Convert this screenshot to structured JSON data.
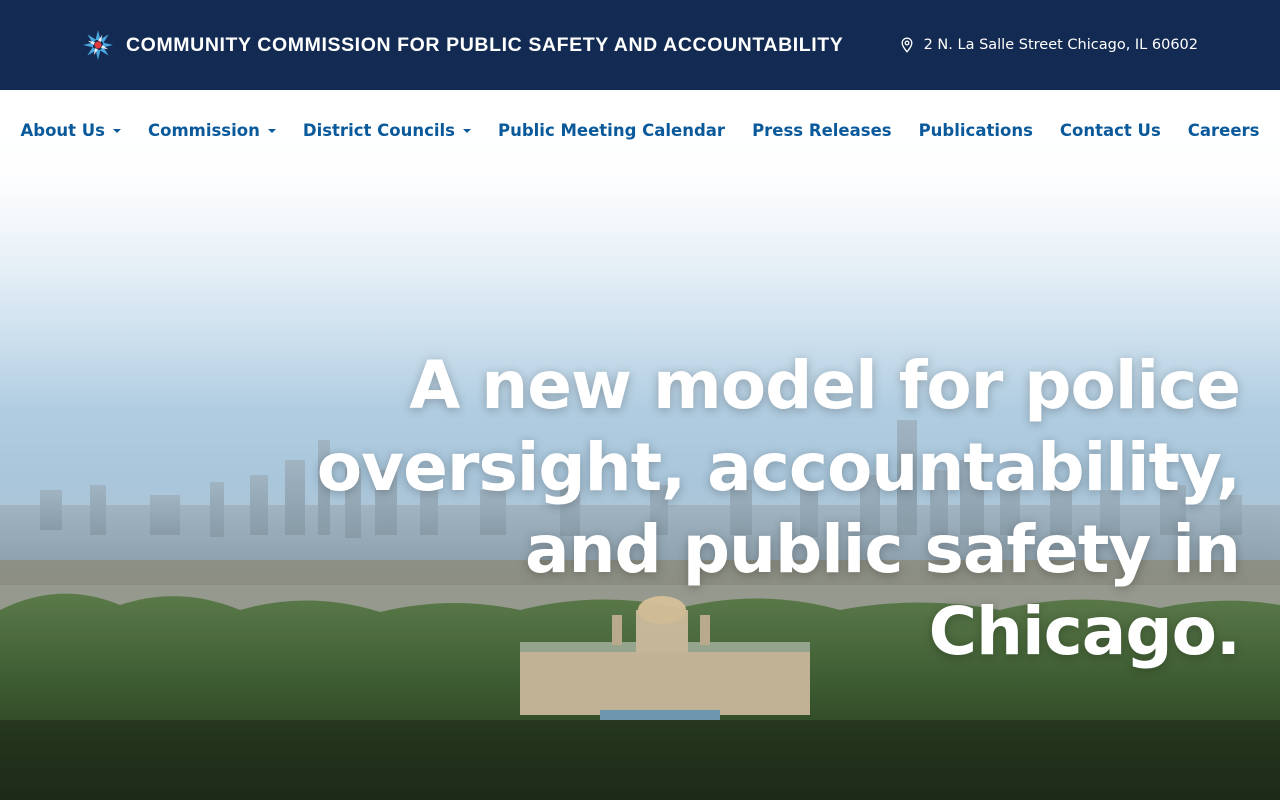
{
  "header": {
    "org_name": "COMMUNITY COMMISSION FOR PUBLIC SAFETY AND ACCOUNTABILITY",
    "logo_icon": "star-burst-logo",
    "address_icon": "location-pin-icon",
    "address": "2 N. La Salle Street Chicago, IL 60602",
    "background_color": "#132b52"
  },
  "nav": {
    "link_color": "#0a5a9b",
    "items": [
      {
        "label": "About Us",
        "dropdown": true
      },
      {
        "label": "Commission",
        "dropdown": true
      },
      {
        "label": "District Councils",
        "dropdown": true
      },
      {
        "label": "Public Meeting Calendar",
        "dropdown": false
      },
      {
        "label": "Press Releases",
        "dropdown": false
      },
      {
        "label": "Publications",
        "dropdown": false
      },
      {
        "label": "Contact Us",
        "dropdown": false
      },
      {
        "label": "Careers",
        "dropdown": false
      }
    ]
  },
  "hero": {
    "heading_lines": [
      "A new model for police",
      "oversight, accountability,",
      "and public safety in Chicago."
    ]
  }
}
